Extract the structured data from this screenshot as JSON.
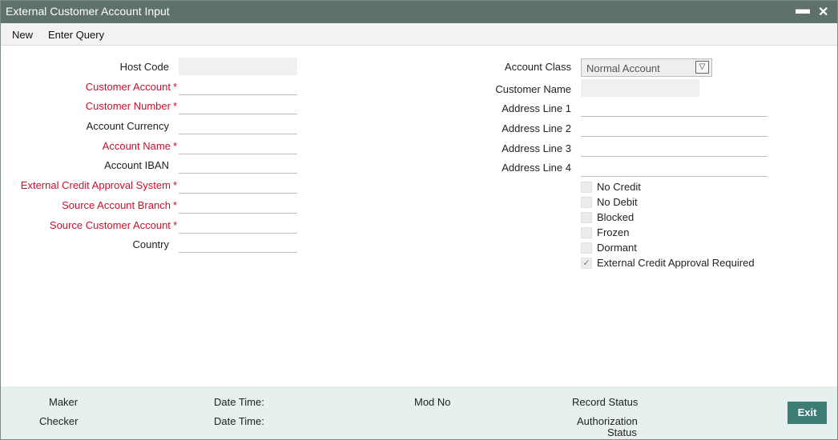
{
  "window": {
    "title": "External Customer Account Input",
    "minimize_glyph": "▬",
    "close_glyph": "✕"
  },
  "menu": {
    "new_label": "New",
    "enter_query_label": "Enter Query"
  },
  "left_fields": {
    "host_code": "Host Code",
    "customer_account": "Customer Account",
    "customer_number": "Customer Number",
    "account_currency": "Account Currency",
    "account_name": "Account Name",
    "account_iban": "Account IBAN",
    "ext_credit_approval_system": "External Credit Approval System",
    "source_account_branch": "Source Account Branch",
    "source_customer_account": "Source Customer Account",
    "country": "Country",
    "required_mark": "*"
  },
  "right_fields": {
    "account_class": "Account Class",
    "account_class_value": "Normal Account",
    "dropdown_glyph": "▽",
    "customer_name": "Customer Name",
    "address_line_1": "Address Line 1",
    "address_line_2": "Address Line 2",
    "address_line_3": "Address Line 3",
    "address_line_4": "Address Line 4"
  },
  "checkboxes": {
    "no_credit": {
      "label": "No Credit",
      "checked": false
    },
    "no_debit": {
      "label": "No Debit",
      "checked": false
    },
    "blocked": {
      "label": "Blocked",
      "checked": false
    },
    "frozen": {
      "label": "Frozen",
      "checked": false
    },
    "dormant": {
      "label": "Dormant",
      "checked": false
    },
    "ext_credit_approval_required": {
      "label": "External Credit Approval Required",
      "checked": true,
      "glyph": "✓"
    }
  },
  "footer": {
    "maker": "Maker",
    "checker": "Checker",
    "date_time_1": "Date Time:",
    "date_time_2": "Date Time:",
    "mod_no": "Mod No",
    "record_status": "Record Status",
    "authorization": "Authorization",
    "status": "Status",
    "exit_label": "Exit"
  },
  "colors": {
    "titlebar": "#5f716c",
    "required_label": "#c8102e",
    "footer_bg": "#e5f0ef",
    "exit_button": "#3c7d73"
  }
}
